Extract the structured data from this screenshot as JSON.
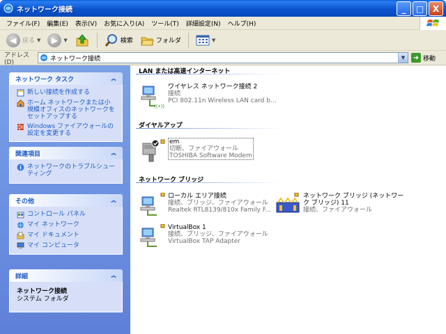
{
  "window": {
    "title": "ネットワーク接続",
    "minimize": "_",
    "maximize": "□",
    "close": "X"
  },
  "menu": [
    "ファイル(F)",
    "編集(E)",
    "表示(V)",
    "お気に入り(A)",
    "ツール(T)",
    "詳細設定(N)",
    "ヘルプ(H)"
  ],
  "toolbar": {
    "back": "戻る",
    "search": "検索",
    "folders": "フォルダ"
  },
  "address": {
    "label": "アドレス(D)",
    "value": "ネットワーク接続",
    "go": "移動"
  },
  "left": {
    "tasks": {
      "title": "ネットワーク タスク",
      "links": [
        "新しい接続を作成する",
        "ホーム ネットワークまたは小規模オフィスのネットワークをセットアップする",
        "Windows ファイアウォールの設定を変更する"
      ]
    },
    "related": {
      "title": "関連項目",
      "links": [
        "ネットワークのトラブルシューティング"
      ]
    },
    "other": {
      "title": "その他",
      "links": [
        "コントロール パネル",
        "マイ ネットワーク",
        "マイ ドキュメント",
        "マイ コンピュータ"
      ]
    },
    "details": {
      "title": "詳細",
      "name": "ネットワーク接続",
      "type": "システム フォルダ"
    }
  },
  "groups": {
    "lan": "LAN または高速インターネット",
    "dialup": "ダイヤルアップ",
    "bridge": "ネットワーク ブリッジ"
  },
  "items": {
    "wireless": {
      "name": "ワイヤレス ネットワーク接続 2",
      "status": "接続",
      "device": "PCI 802.11n Wireless LAN card b..."
    },
    "em": {
      "name": "em",
      "status": "切断、ファイアウォール",
      "device": "TOSHIBA Software Modem"
    },
    "local": {
      "name": "ローカル エリア接続",
      "status": "接続、ブリッジ、ファイアウォール",
      "device": "Realtek RTL8139/810x Family F..."
    },
    "vbox": {
      "name": "VirtualBox 1",
      "status": "接続、ブリッジ、ファイアウォール",
      "device": "VirtualBox TAP Adapter"
    },
    "bridge": {
      "name": "ネットワーク ブリッジ (ネットワーク ブリッジ) 11",
      "status": "接続、ファイアウォール"
    }
  }
}
